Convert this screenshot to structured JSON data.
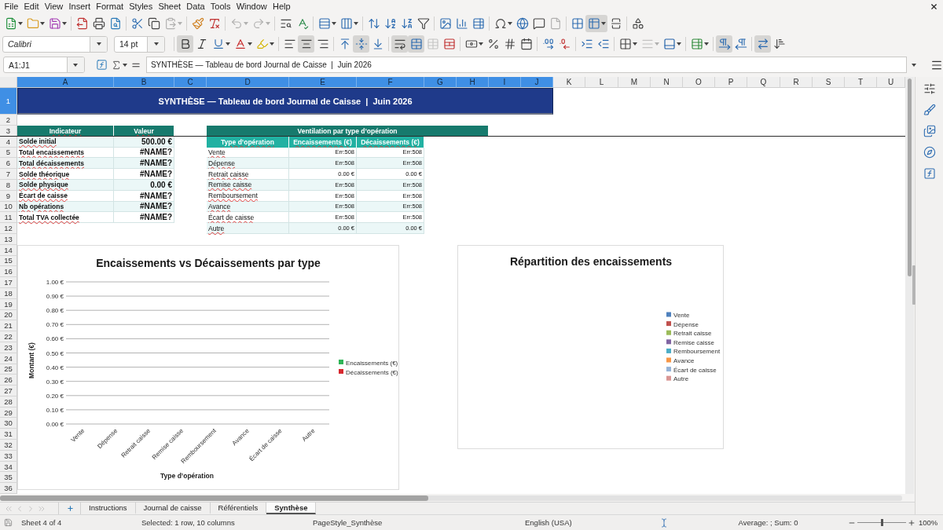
{
  "menu_bar": {
    "items": [
      "File",
      "Edit",
      "View",
      "Insert",
      "Format",
      "Styles",
      "Sheet",
      "Data",
      "Tools",
      "Window",
      "Help"
    ]
  },
  "standard_toolbar": [
    {
      "on": false,
      "disabled": false
    },
    {
      "on": false,
      "disabled": false
    },
    {
      "on": false,
      "disabled": false
    },
    {
      "on": false,
      "disabled": false
    },
    {
      "on": false,
      "disabled": false
    },
    {
      "on": false,
      "disabled": false
    },
    {
      "on": false,
      "disabled": false
    },
    {
      "on": false,
      "disabled": false
    },
    {
      "on": false,
      "disabled": true
    },
    {
      "on": false,
      "disabled": false
    },
    {
      "on": false,
      "disabled": false
    },
    {
      "on": false,
      "disabled": true
    },
    {
      "on": false,
      "disabled": true
    },
    {
      "on": false,
      "disabled": false
    },
    {
      "on": false,
      "disabled": false
    },
    {
      "on": false,
      "disabled": false
    },
    {
      "on": false,
      "disabled": false
    },
    {
      "on": false,
      "disabled": false
    },
    {
      "on": false,
      "disabled": false
    },
    {
      "on": false,
      "disabled": false
    },
    {
      "on": false,
      "disabled": false
    },
    {
      "on": false,
      "disabled": false
    },
    {
      "on": false,
      "disabled": false
    },
    {
      "on": false,
      "disabled": false
    },
    {
      "on": false,
      "disabled": false
    },
    {
      "on": false,
      "disabled": false
    },
    {
      "on": false,
      "disabled": false
    },
    {
      "on": false,
      "disabled": true
    },
    {
      "on": false,
      "disabled": false
    },
    {
      "on": true,
      "disabled": false
    },
    {
      "on": false,
      "disabled": false
    },
    {
      "on": false,
      "disabled": false
    }
  ],
  "formatting_toolbar": {
    "font_name": "Calibri",
    "font_size": "14 pt",
    "buttons": [
      {
        "on": true,
        "disabled": false
      },
      {
        "on": false,
        "disabled": false
      },
      {
        "on": false,
        "disabled": false
      },
      {
        "on": false,
        "disabled": false
      },
      {
        "on": false,
        "disabled": false
      },
      {
        "on": false,
        "disabled": false
      },
      {
        "on": true,
        "disabled": false
      },
      {
        "on": false,
        "disabled": false
      },
      {
        "on": false,
        "disabled": false
      },
      {
        "on": true,
        "disabled": false
      },
      {
        "on": false,
        "disabled": false
      },
      {
        "on": true,
        "disabled": false
      },
      {
        "on": true,
        "disabled": false
      },
      {
        "on": false,
        "disabled": true
      },
      {
        "on": false,
        "disabled": false
      },
      {
        "on": false,
        "disabled": false
      },
      {
        "on": false,
        "disabled": false
      },
      {
        "on": false,
        "disabled": false
      },
      {
        "on": false,
        "disabled": false
      },
      {
        "on": false,
        "disabled": false
      },
      {
        "on": false,
        "disabled": false
      },
      {
        "on": false,
        "disabled": false
      },
      {
        "on": false,
        "disabled": false
      },
      {
        "on": false,
        "disabled": false
      },
      {
        "on": false,
        "disabled": true
      },
      {
        "on": false,
        "disabled": false
      },
      {
        "on": false,
        "disabled": false
      },
      {
        "on": true,
        "disabled": false
      },
      {
        "on": false,
        "disabled": false
      },
      {
        "on": true,
        "disabled": false
      },
      {
        "on": false,
        "disabled": false
      }
    ]
  },
  "formula_bar": {
    "name_box": "A1:J1",
    "formula": "SYNTHÈSE — Tableau de bord Journal de Caisse  |  Juin 2026"
  },
  "sheet": {
    "columns": [
      {
        "label": "A",
        "selected": true
      },
      {
        "label": "B",
        "selected": true
      },
      {
        "label": "C",
        "selected": true
      },
      {
        "label": "D",
        "selected": true
      },
      {
        "label": "E",
        "selected": true
      },
      {
        "label": "F",
        "selected": true
      },
      {
        "label": "G",
        "selected": true
      },
      {
        "label": "H",
        "selected": true
      },
      {
        "label": "I",
        "selected": true
      },
      {
        "label": "J",
        "selected": true
      },
      {
        "label": "K",
        "selected": false
      },
      {
        "label": "L",
        "selected": false
      },
      {
        "label": "M",
        "selected": false
      },
      {
        "label": "N",
        "selected": false
      },
      {
        "label": "O",
        "selected": false
      },
      {
        "label": "P",
        "selected": false
      },
      {
        "label": "Q",
        "selected": false
      },
      {
        "label": "R",
        "selected": false
      },
      {
        "label": "S",
        "selected": false
      },
      {
        "label": "T",
        "selected": false
      },
      {
        "label": "U",
        "selected": false
      }
    ],
    "rows": [
      {
        "label": "1",
        "selected": true
      },
      {
        "label": "2",
        "selected": false
      },
      {
        "label": "3",
        "selected": false
      },
      {
        "label": "4",
        "selected": false
      },
      {
        "label": "5",
        "selected": false
      },
      {
        "label": "6",
        "selected": false
      },
      {
        "label": "7",
        "selected": false
      },
      {
        "label": "8",
        "selected": false
      },
      {
        "label": "9",
        "selected": false
      },
      {
        "label": "10",
        "selected": false
      },
      {
        "label": "11",
        "selected": false
      },
      {
        "label": "12",
        "selected": false
      },
      {
        "label": "13",
        "selected": false
      },
      {
        "label": "14",
        "selected": false
      },
      {
        "label": "15",
        "selected": false
      },
      {
        "label": "16",
        "selected": false
      },
      {
        "label": "17",
        "selected": false
      },
      {
        "label": "18",
        "selected": false
      },
      {
        "label": "19",
        "selected": false
      },
      {
        "label": "20",
        "selected": false
      },
      {
        "label": "21",
        "selected": false
      },
      {
        "label": "22",
        "selected": false
      },
      {
        "label": "23",
        "selected": false
      },
      {
        "label": "24",
        "selected": false
      },
      {
        "label": "25",
        "selected": false
      },
      {
        "label": "26",
        "selected": false
      },
      {
        "label": "27",
        "selected": false
      },
      {
        "label": "28",
        "selected": false
      },
      {
        "label": "29",
        "selected": false
      },
      {
        "label": "30",
        "selected": false
      },
      {
        "label": "31",
        "selected": false
      },
      {
        "label": "32",
        "selected": false
      },
      {
        "label": "33",
        "selected": false
      },
      {
        "label": "34",
        "selected": false
      },
      {
        "label": "35",
        "selected": false
      },
      {
        "label": "36",
        "selected": false
      }
    ],
    "title": "SYNTHÈSE — Tableau de bord Journal de Caisse  |  Juin 2026",
    "summary": {
      "headers": [
        "Indicateur",
        "Valeur"
      ],
      "rows": [
        {
          "label": "Solde initial",
          "value": "500.00 €"
        },
        {
          "label": "Total encaissements",
          "value": "#NAME?"
        },
        {
          "label": "Total décaissements",
          "value": "#NAME?"
        },
        {
          "label": "Solde théorique",
          "value": "#NAME?"
        },
        {
          "label": "Solde physique",
          "value": "0.00 €"
        },
        {
          "label": "Écart de caisse",
          "value": "#NAME?"
        },
        {
          "label": "Nb opérations",
          "value": "#NAME?"
        },
        {
          "label": "Total TVA collectée",
          "value": "#NAME?"
        }
      ]
    },
    "breakdown": {
      "title": "Ventilation par type d’opération",
      "headers": [
        "Type d’opération",
        "Encaissements (€)",
        "Décaissements (€)"
      ],
      "rows": [
        [
          "Vente",
          "Err:508",
          "Err:508"
        ],
        [
          "Dépense",
          "Err:508",
          "Err:508"
        ],
        [
          "Retrait caisse",
          "0.00 €",
          "0.00 €"
        ],
        [
          "Remise caisse",
          "Err:508",
          "Err:508"
        ],
        [
          "Remboursement",
          "Err:508",
          "Err:508"
        ],
        [
          "Avance",
          "Err:508",
          "Err:508"
        ],
        [
          "Écart de caisse",
          "Err:508",
          "Err:508"
        ],
        [
          "Autre",
          "0.00 €",
          "0.00 €"
        ]
      ]
    },
    "charts": [
      {
        "chart_data": {
          "type": "bar",
          "title": "Encaissements vs Décaissements par type",
          "xlabel": "Type d’opération",
          "ylabel": "Montant (€)",
          "categories": [
            "Vente",
            "Dépense",
            "Retrait caisse",
            "Remise caisse",
            "Remboursement",
            "Avance",
            "Écart de caisse",
            "Autre"
          ],
          "series": [
            {
              "name": "Encaissements (€)",
              "color": "#2fb457",
              "values": [
                null,
                null,
                0,
                null,
                null,
                null,
                null,
                0
              ]
            },
            {
              "name": "Décaissements (€)",
              "color": "#d7282f",
              "values": [
                null,
                null,
                0,
                null,
                null,
                null,
                null,
                0
              ]
            }
          ],
          "ylim": [
            0,
            1
          ],
          "yticks": [
            {
              "value": 0,
              "label": "0.00 €"
            },
            {
              "value": 0.1,
              "label": "0.10 €"
            },
            {
              "value": 0.2,
              "label": "0.20 €"
            },
            {
              "value": 0.3,
              "label": "0.30 €"
            },
            {
              "value": 0.4,
              "label": "0.40 €"
            },
            {
              "value": 0.5,
              "label": "0.50 €"
            },
            {
              "value": 0.6,
              "label": "0.60 €"
            },
            {
              "value": 0.7,
              "label": "0.70 €"
            },
            {
              "value": 0.8,
              "label": "0.80 €"
            },
            {
              "value": 0.9,
              "label": "0.90 €"
            },
            {
              "value": 1,
              "label": "1.00 €"
            }
          ],
          "grid": true
        }
      },
      {
        "chart_data": {
          "type": "pie",
          "title": "Répartition des encaissements"
        },
        "legend": [
          {
            "label": "Vente",
            "color": "#4f81bd"
          },
          {
            "label": "Dépense",
            "color": "#c0504d"
          },
          {
            "label": "Retrait caisse",
            "color": "#9bbb59"
          },
          {
            "label": "Remise caisse",
            "color": "#8064a2"
          },
          {
            "label": "Remboursement",
            "color": "#4bacc6"
          },
          {
            "label": "Avance",
            "color": "#f79646"
          },
          {
            "label": "Écart de caisse",
            "color": "#95b3d7"
          },
          {
            "label": "Autre",
            "color": "#d99694"
          }
        ]
      }
    ]
  },
  "sheet_tab_nav": [
    {
      "disabled": true
    },
    {
      "disabled": true
    },
    {
      "disabled": true
    },
    {
      "disabled": true
    }
  ],
  "sheet_tabs": [
    {
      "label": "Instructions",
      "selected": false
    },
    {
      "label": "Journal de caisse",
      "selected": false
    },
    {
      "label": "Référentiels",
      "selected": false
    },
    {
      "label": "Synthèse",
      "selected": true
    }
  ],
  "status_bar": {
    "sheet": "Sheet 4 of 4",
    "selection": "Selected: 1 row, 10 columns",
    "page_style": "PageStyle_Synthèse",
    "language": "English (USA)",
    "statistics": "Average: ; Sum: 0",
    "zoom_slider": {
      "level": 0.5
    },
    "zoom": "100%"
  }
}
